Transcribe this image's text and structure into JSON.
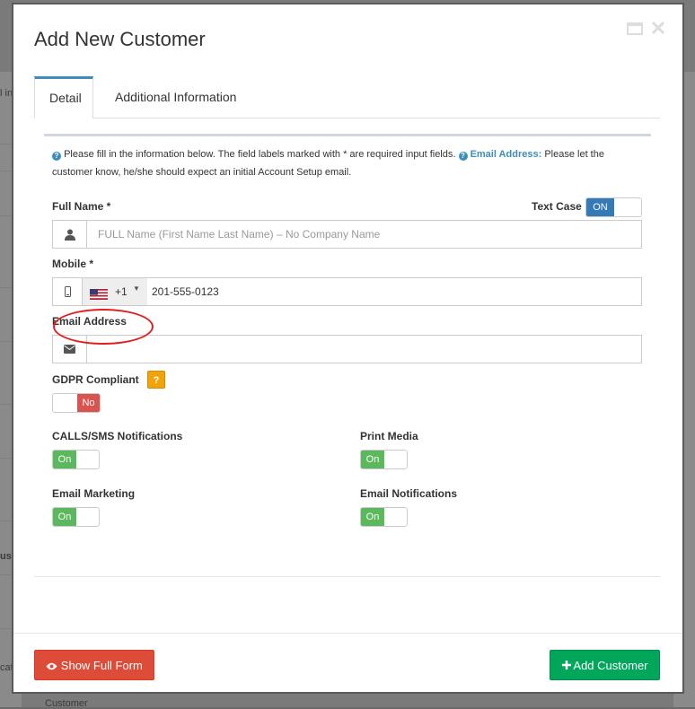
{
  "modal": {
    "title": "Add New Customer",
    "controls": {
      "maximize": "maximize-icon",
      "close": "close-icon"
    }
  },
  "tabs": [
    {
      "label": "Detail",
      "active": true
    },
    {
      "label": "Additional Information",
      "active": false
    }
  ],
  "info": {
    "text": "Please fill in the information below. The field labels marked with * are required input fields.",
    "email_label": "Email Address:",
    "email_text": "Please let the customer know, he/she should expect an initial Account Setup email."
  },
  "full_name": {
    "label": "Full Name *",
    "placeholder": "FULL Name (First Name Last Name) – No Company Name",
    "value": "",
    "icon": "user-icon"
  },
  "text_case": {
    "label": "Text Case",
    "state": "ON"
  },
  "mobile": {
    "label": "Mobile *",
    "icon": "mobile-icon",
    "country_code": "+1",
    "value": "201-555-0123"
  },
  "email": {
    "label": "Email Address",
    "icon": "envelope-icon",
    "value": ""
  },
  "gdpr": {
    "label": "GDPR Compliant",
    "help": "?",
    "state": "No"
  },
  "toggles": {
    "calls_sms": {
      "label": "CALLS/SMS Notifications",
      "state": "On"
    },
    "print_media": {
      "label": "Print Media",
      "state": "On"
    },
    "email_marketing": {
      "label": "Email Marketing",
      "state": "On"
    },
    "email_notifications": {
      "label": "Email Notifications",
      "state": "On"
    }
  },
  "buttons": {
    "show_full_form": "Show Full Form",
    "add_customer": "Add Customer"
  },
  "background": {
    "text1": "l inpu",
    "text2": "uspe",
    "text3": "cate",
    "text4": "Customer"
  },
  "colors": {
    "primary": "#3c8dbc",
    "toggle_on_blue": "#337ab7",
    "toggle_on_green": "#5cb85c",
    "toggle_no_red": "#d9534f",
    "btn_red": "#dd4b39",
    "btn_green": "#00a65a",
    "help_orange": "#f0a30a",
    "annotation_red": "#e02020"
  }
}
